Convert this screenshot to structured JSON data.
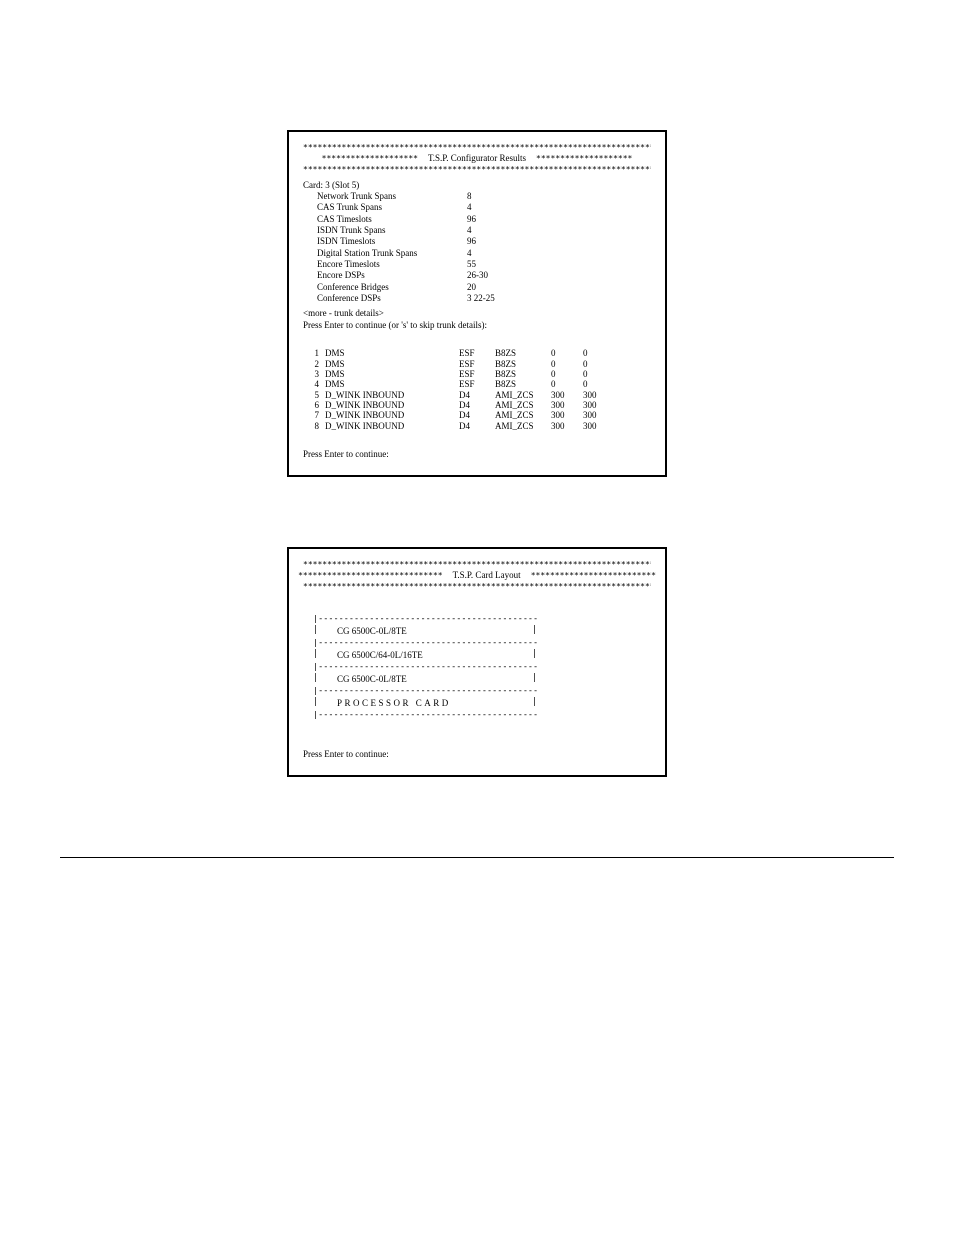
{
  "decor": {
    "stars_full": "*****************************************************************************",
    "stars_short_left": "********************",
    "stars_short_right": "********************",
    "stars_med_left": "******************************",
    "stars_med_right": "**************************",
    "dash_line": "|-------------------------------------------|"
  },
  "panel1": {
    "title": "T.S.P. Configurator Results",
    "card_header": "Card: 3 (Slot 5)",
    "rows": [
      {
        "label": "Network Trunk Spans",
        "value": "8"
      },
      {
        "label": "CAS Trunk Spans",
        "value": "4"
      },
      {
        "label": "CAS Timeslots",
        "value": "96"
      },
      {
        "label": "ISDN Trunk Spans",
        "value": "4"
      },
      {
        "label": "ISDN Timeslots",
        "value": "96"
      },
      {
        "label": "Digital Station Trunk Spans",
        "value": "4"
      },
      {
        "label": "Encore Timeslots",
        "value": "55"
      },
      {
        "label": "Encore DSPs",
        "value": "26-30"
      },
      {
        "label": "Conference Bridges",
        "value": "20"
      },
      {
        "label": "Conference DSPs",
        "value": "3 22-25"
      }
    ],
    "more": "<more - trunk details>",
    "prompt": "Press Enter to continue (or 's' to skip trunk details):",
    "trunks": [
      {
        "idx": "1",
        "type": "DMS",
        "frame": "ESF",
        "code": "B8ZS",
        "a": "0",
        "b": "0"
      },
      {
        "idx": "2",
        "type": "DMS",
        "frame": "ESF",
        "code": "B8ZS",
        "a": "0",
        "b": "0"
      },
      {
        "idx": "3",
        "type": "DMS",
        "frame": "ESF",
        "code": "B8ZS",
        "a": "0",
        "b": "0"
      },
      {
        "idx": "4",
        "type": "DMS",
        "frame": "ESF",
        "code": "B8ZS",
        "a": "0",
        "b": "0"
      },
      {
        "idx": "5",
        "type": "D_WINK INBOUND",
        "frame": "D4",
        "code": "AMI_ZCS",
        "a": "300",
        "b": "300"
      },
      {
        "idx": "6",
        "type": "D_WINK INBOUND",
        "frame": "D4",
        "code": "AMI_ZCS",
        "a": "300",
        "b": "300"
      },
      {
        "idx": "7",
        "type": "D_WINK INBOUND",
        "frame": "D4",
        "code": "AMI_ZCS",
        "a": "300",
        "b": "300"
      },
      {
        "idx": "8",
        "type": "D_WINK INBOUND",
        "frame": "D4",
        "code": "AMI_ZCS",
        "a": "300",
        "b": "300"
      }
    ],
    "prompt2": "Press Enter to continue:"
  },
  "panel2": {
    "title": "T.S.P. Card Layout",
    "slots": [
      {
        "label": "CG 6500C-0L/8TE",
        "spaced": false
      },
      {
        "label": "CG 6500C/64-0L/16TE",
        "spaced": false
      },
      {
        "label": "CG 6500C-0L/8TE",
        "spaced": false
      },
      {
        "label": "PROCESSOR CARD",
        "spaced": true
      }
    ],
    "prompt": "Press Enter to continue:"
  }
}
